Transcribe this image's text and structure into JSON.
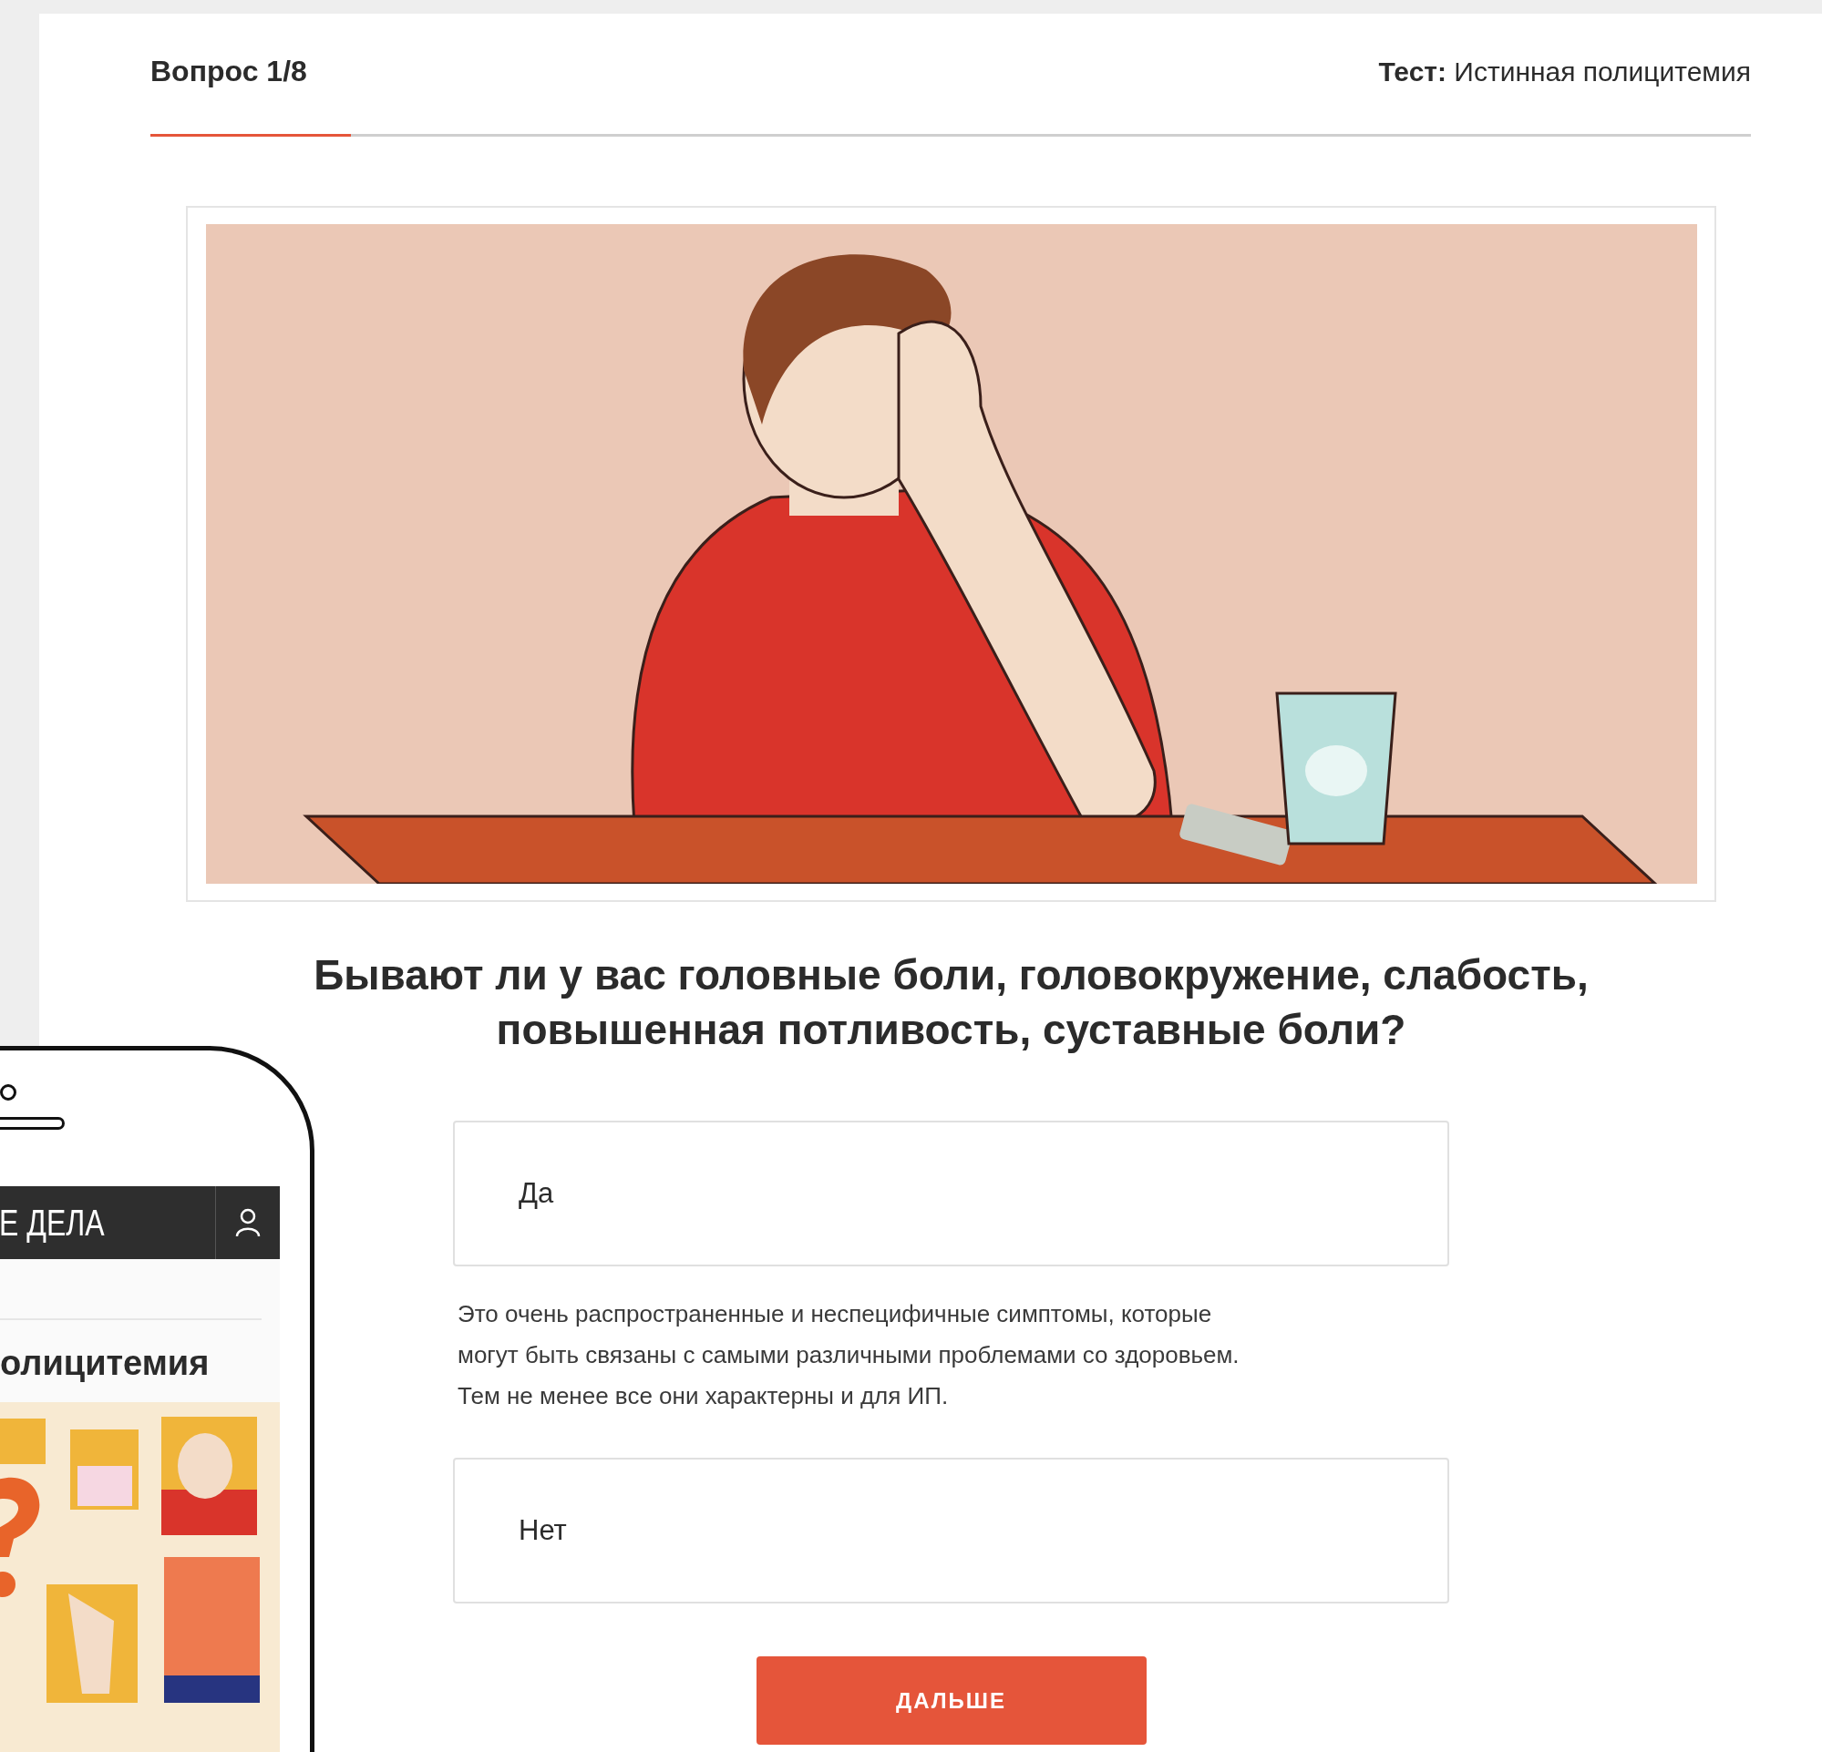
{
  "header": {
    "progress_label": "Вопрос 1/8",
    "progress": {
      "level": 0.125
    },
    "test_title": "**Тест:** Истинная полицитемия"
  },
  "question": "Бывают ли у вас головные боли, головокружение, слабость, повышенная потливость, суставные боли?",
  "answers": [
    {
      "label": "Да",
      "explanation": "Это очень распространенные и неспецифичные симптомы, которые могут быть связаны с самыми различными проблемами со здоровьем. Тем не менее все они характерны и для ИП."
    },
    {
      "label": "Нет"
    }
  ],
  "next_button": "ДАЛЬШЕ",
  "phone": {
    "header_title": "Е ДЕЛА",
    "page_title": "олицитемия"
  }
}
